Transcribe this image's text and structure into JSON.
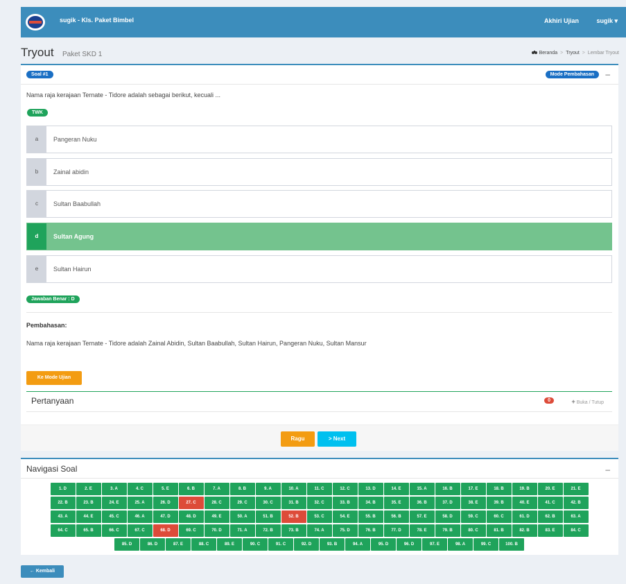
{
  "header": {
    "app_title": "sugik - Kls. Paket Bimbel",
    "end_exam_label": "Akhiri Ujian",
    "user_name": "sugik",
    "caret": "▾"
  },
  "page": {
    "title": "Tryout",
    "subtitle": "Paket SKD 1",
    "breadcrumb": [
      "Beranda",
      "Tryout",
      "Lembar Tryout"
    ]
  },
  "question": {
    "number_badge": "Soal #1",
    "mode_badge": "Mode Pembahasan",
    "collapse": "–",
    "text": "Nama raja kerajaan Ternate - Tidore adalah sebagai berikut, kecuali ...",
    "category": "TWK",
    "options": [
      {
        "letter": "a",
        "text": "Pangeran Nuku"
      },
      {
        "letter": "b",
        "text": "Zainal abidin"
      },
      {
        "letter": "c",
        "text": "Sultan Baabullah"
      },
      {
        "letter": "d",
        "text": "Sultan Agung"
      },
      {
        "letter": "e",
        "text": "Sultan Hairun"
      }
    ],
    "correct_index": 3,
    "answer_badge": "Jawaban Benar : D",
    "discussion_title": "Pembahasan:",
    "discussion_text": "Nama raja kerajaan Ternate - Tidore adalah Zainal Abidin, Sultan Baabullah, Sultan Hairun, Pangeran Nuku, Sultan Mansur",
    "exam_mode_button": "Ke Mode Ujian",
    "questions_panel_title": "Pertanyaan",
    "questions_count": "0",
    "toggle_label": "Buka / Tutup",
    "doubt_button": "Ragu",
    "next_button": "Next"
  },
  "navigation": {
    "title": "Navigasi Soal",
    "collapse": "–",
    "items": [
      "1. D",
      "2. E",
      "3. A",
      "4. C",
      "5. E",
      "6. B",
      "7. A",
      "8. B",
      "9. A",
      "10. A",
      "11. C",
      "12. C",
      "13. D",
      "14. E",
      "15. A",
      "16. B",
      "17. E",
      "18. B",
      "19. B",
      "20. E",
      "21. E",
      "22. B",
      "23. B",
      "24. E",
      "25. A",
      "26. D",
      "27. C",
      "28. C",
      "29. C",
      "30. C",
      "31. B",
      "32. C",
      "33. B",
      "34. B",
      "35. E",
      "36. B",
      "37. D",
      "38. E",
      "39. B",
      "40. E",
      "41. C",
      "42. B",
      "43. A",
      "44. E",
      "45. C",
      "46. A",
      "47. D",
      "48. D",
      "49. E",
      "50. A",
      "51. B",
      "52. B",
      "53. C",
      "54. E",
      "55. B",
      "56. B",
      "57. E",
      "58. D",
      "59. C",
      "60. C",
      "61. D",
      "62. B",
      "63. A",
      "64. C",
      "65. B",
      "66. C",
      "67. C",
      "68. D",
      "69. C",
      "70. D",
      "71. A",
      "72. B",
      "73. B",
      "74. A",
      "75. D",
      "76. B",
      "77. D",
      "78. E",
      "79. B",
      "80. C",
      "81. B",
      "82. B",
      "83. E",
      "84. C",
      "85. D",
      "86. D",
      "87. E",
      "88. C",
      "89. E",
      "90. C",
      "91. C",
      "92. D",
      "93. B",
      "94. A",
      "95. D",
      "96. D",
      "97. E",
      "98. A",
      "99. C",
      "100. B"
    ],
    "doubt_indexes": [
      26,
      51,
      67
    ]
  },
  "back_button": "Kembali",
  "colors": {
    "primary": "#3c8dbc",
    "success": "#1fa35b",
    "danger": "#dd4b39",
    "warning": "#f39c12",
    "info": "#00c0ef"
  }
}
